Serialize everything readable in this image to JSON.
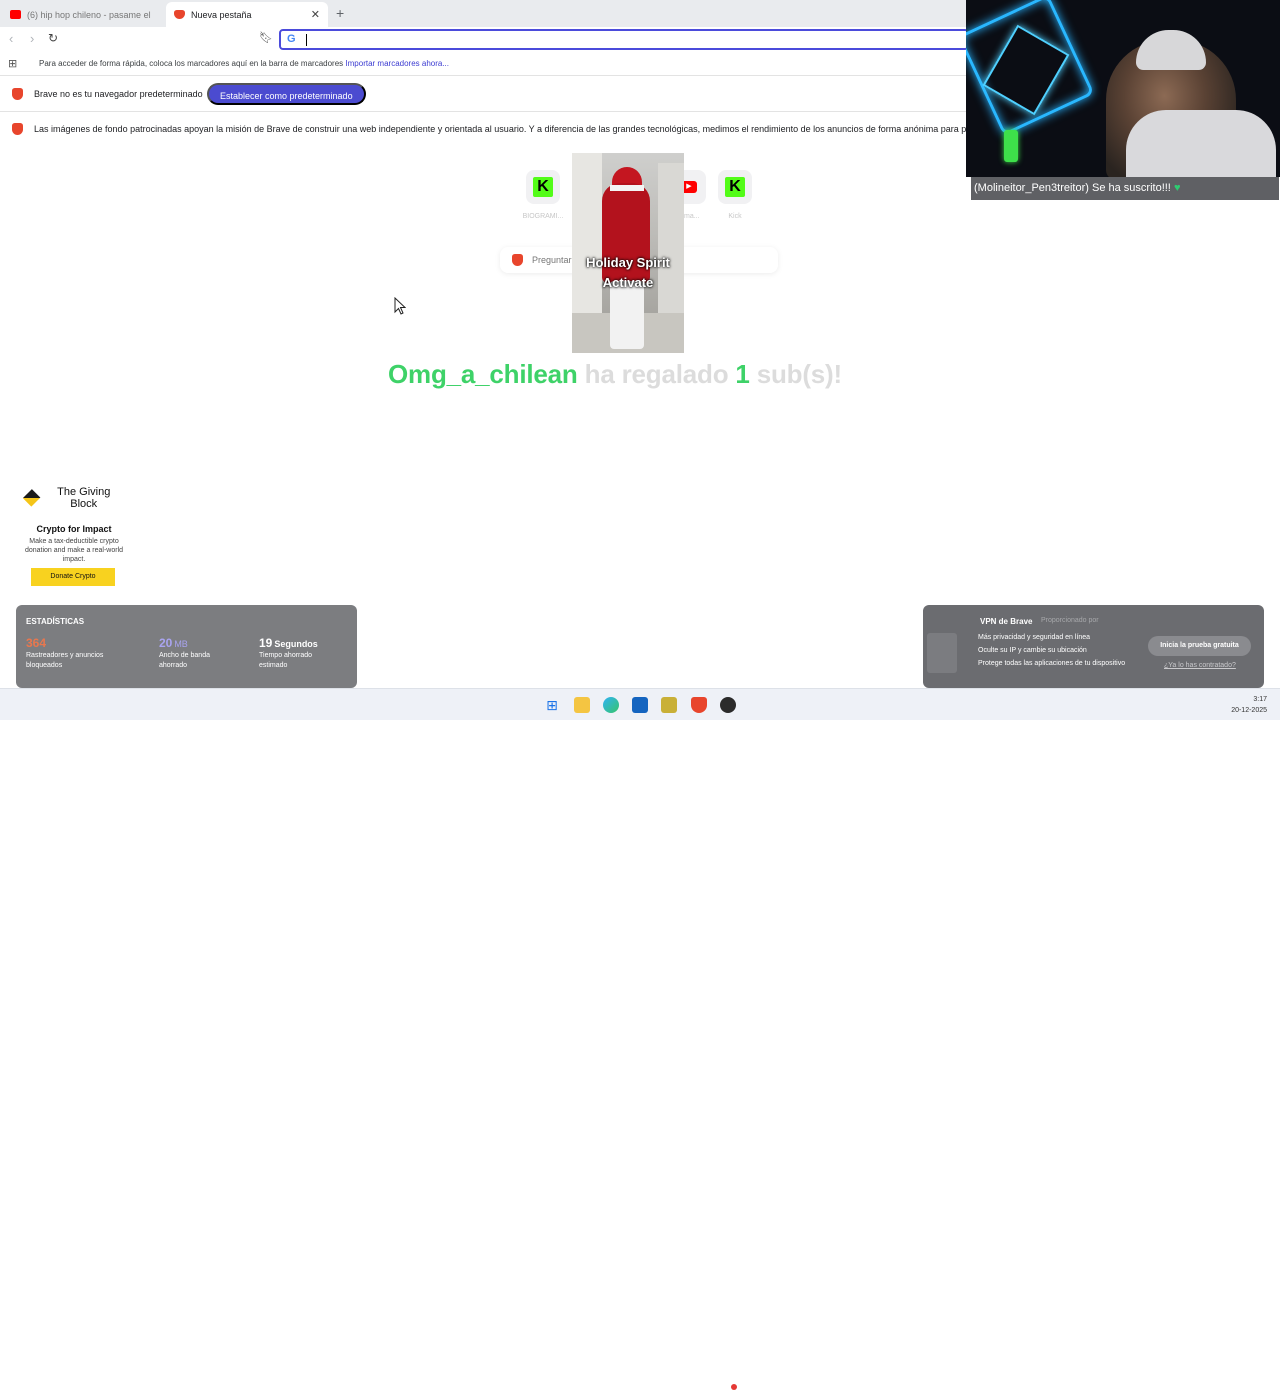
{
  "tabs": [
    {
      "title": "(6) hip hop chileno - pasame el m",
      "favicon": "youtube-icon"
    },
    {
      "title": "Nueva pestaña",
      "favicon": "brave-lion-icon"
    }
  ],
  "omnibox": {
    "value": "",
    "engine_icon": "google-g-icon"
  },
  "bookmark_bar": {
    "prompt": "Para acceder de forma rápida, coloca los marcadores aquí en la barra de marcadores",
    "import_link": "Importar marcadores ahora..."
  },
  "default_browser_bar": {
    "message": "Brave no es tu navegador predeterminado",
    "button": "Establecer como predeterminado"
  },
  "sponsor_bar": {
    "message": "Las imágenes de fondo patrocinadas apoyan la misión de Brave de construir una web independiente y orientada al usuario. Y a diferencia de las grandes tecnológicas, medimos el rendimiento de los anuncios de forma anónima para preservar tu"
  },
  "shortcuts": [
    {
      "label": "BIOGRAMI...",
      "icon": "kick-icon"
    },
    {
      "label": "ima...",
      "icon": "youtube-icon"
    },
    {
      "label": "Kick",
      "icon": "kick-icon"
    }
  ],
  "search_box": {
    "prompt": "Preguntar"
  },
  "alert": {
    "video_caption": "Holiday Spirit Activate",
    "gifter": "Omg_a_chilean",
    "text_before": "ha regalado",
    "count": "1",
    "text_after": "sub(s)!"
  },
  "webcam": {
    "subscriber_message": "(Molineitor_Pen3treitor) Se ha suscrito!!!",
    "heart_icon": "green-heart-icon"
  },
  "giving_block": {
    "logo_text": "The Giving Block",
    "title": "Crypto for Impact",
    "description": "Make a tax-deductible crypto donation and make a real-world impact.",
    "button": "Donate Crypto"
  },
  "stats": {
    "heading": "ESTADÍSTICAS",
    "trackers": {
      "value": "364",
      "label": "Rastreadores y anuncios bloqueados",
      "color": "#e8774e"
    },
    "bandwidth": {
      "value": "20",
      "unit": "MB",
      "label": "Ancho de banda ahorrado",
      "color": "#a9a4f0"
    },
    "time": {
      "value": "19",
      "unit": "Segundos",
      "label": "Tiempo ahorrado estimado"
    }
  },
  "vpn": {
    "title": "VPN de Brave",
    "provider": "Proporcionado por",
    "features": [
      "Más privacidad y seguridad en línea",
      "Oculte su IP y cambie su ubicación",
      "Protege todas las aplicaciones de tu dispositivo"
    ],
    "button": "Inicia la prueba gratuita",
    "link": "¿Ya lo has contratado?"
  },
  "taskbar": {
    "icons": [
      "windows-start-icon",
      "file-explorer-icon",
      "edge-icon",
      "outlook-icon",
      "app-icon",
      "brave-icon",
      "obs-icon"
    ],
    "time": "3:17",
    "date": "20-12-2025"
  },
  "colors": {
    "accent": "#4b4bd0",
    "gift_green": "#3ed268"
  }
}
